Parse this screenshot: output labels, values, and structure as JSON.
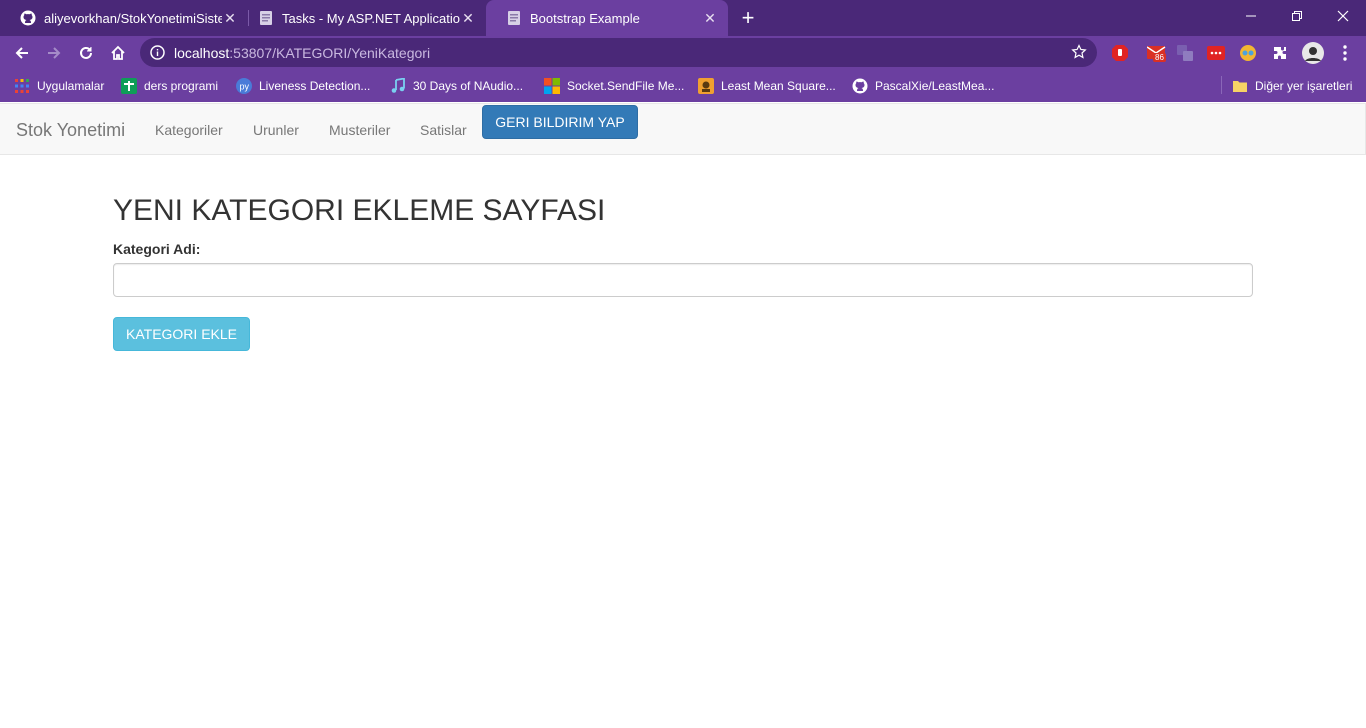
{
  "browser": {
    "tabs": [
      {
        "title": "aliyevorkhan/StokYonetimiSistemi",
        "icon": "github-icon",
        "active": false
      },
      {
        "title": "Tasks - My ASP.NET Application",
        "icon": "document-icon",
        "active": false
      },
      {
        "title": "Bootstrap Example",
        "icon": "document-icon",
        "active": true
      }
    ],
    "new_tab_label": "+",
    "close_glyph": "✕",
    "address": {
      "host": "localhost",
      "rest": ":53807/KATEGORI/YeniKategori"
    },
    "extensions": {
      "mail_badge": "86"
    },
    "bookmarks": [
      {
        "label": "Uygulamalar",
        "icon": "apps-grid-icon"
      },
      {
        "label": "ders programi",
        "icon": "spreadsheet-icon"
      },
      {
        "label": "Liveness Detection...",
        "icon": "pyimagesearch-icon"
      },
      {
        "label": "30 Days of NAudio...",
        "icon": "music-note-icon"
      },
      {
        "label": "Socket.SendFile Me...",
        "icon": "microsoft-icon"
      },
      {
        "label": "Least Mean Square...",
        "icon": "site-icon"
      },
      {
        "label": "PascalXie/LeastMea...",
        "icon": "github-icon"
      }
    ],
    "other_bookmarks": "Diğer yer işaretleri"
  },
  "navbar": {
    "brand": "Stok Yonetimi",
    "links": [
      "Kategoriler",
      "Urunler",
      "Musteriler",
      "Satislar"
    ],
    "feedback_button": "GERI BILDIRIM YAP"
  },
  "form": {
    "title": "YENI KATEGORI EKLEME SAYFASI",
    "label": "Kategori Adi:",
    "input_value": "",
    "submit": "KATEGORI EKLE"
  },
  "colors": {
    "tabstrip": "#4a2878",
    "toolbar": "#6b3fa0",
    "primary_button": "#337ab7",
    "info_button": "#5bc0de"
  }
}
